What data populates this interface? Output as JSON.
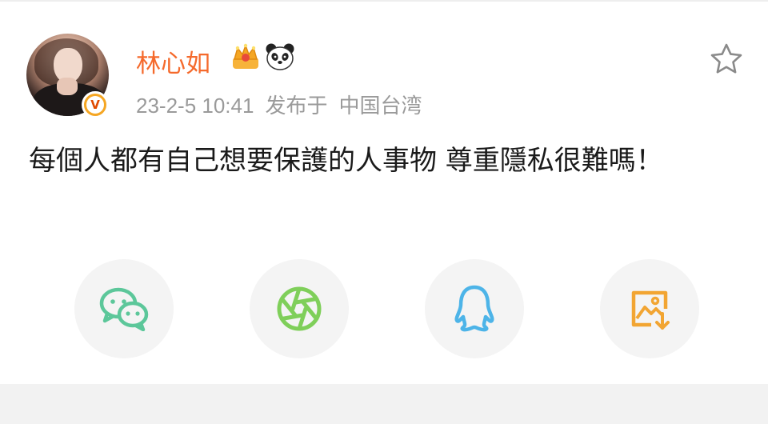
{
  "post": {
    "author": {
      "name": "林心如",
      "verified_badge": "V",
      "badges": [
        "crown-icon",
        "panda-icon"
      ]
    },
    "meta": {
      "time": "23-2-5 10:41",
      "posted_from_label": "发布于",
      "location": "中国台湾"
    },
    "text": "每個人都有自己想要保護的人事物 尊重隱私很難嗎！"
  },
  "share_buttons": [
    {
      "icon": "wechat-icon",
      "color": "#5cc79a"
    },
    {
      "icon": "moments-icon",
      "color": "#7fcf5a"
    },
    {
      "icon": "qq-icon",
      "color": "#4db4e8"
    },
    {
      "icon": "save-image-icon",
      "color": "#f2a532"
    }
  ],
  "colors": {
    "username": "#f56a2c",
    "meta": "#9a9a9a",
    "verified": "#f5a623"
  }
}
